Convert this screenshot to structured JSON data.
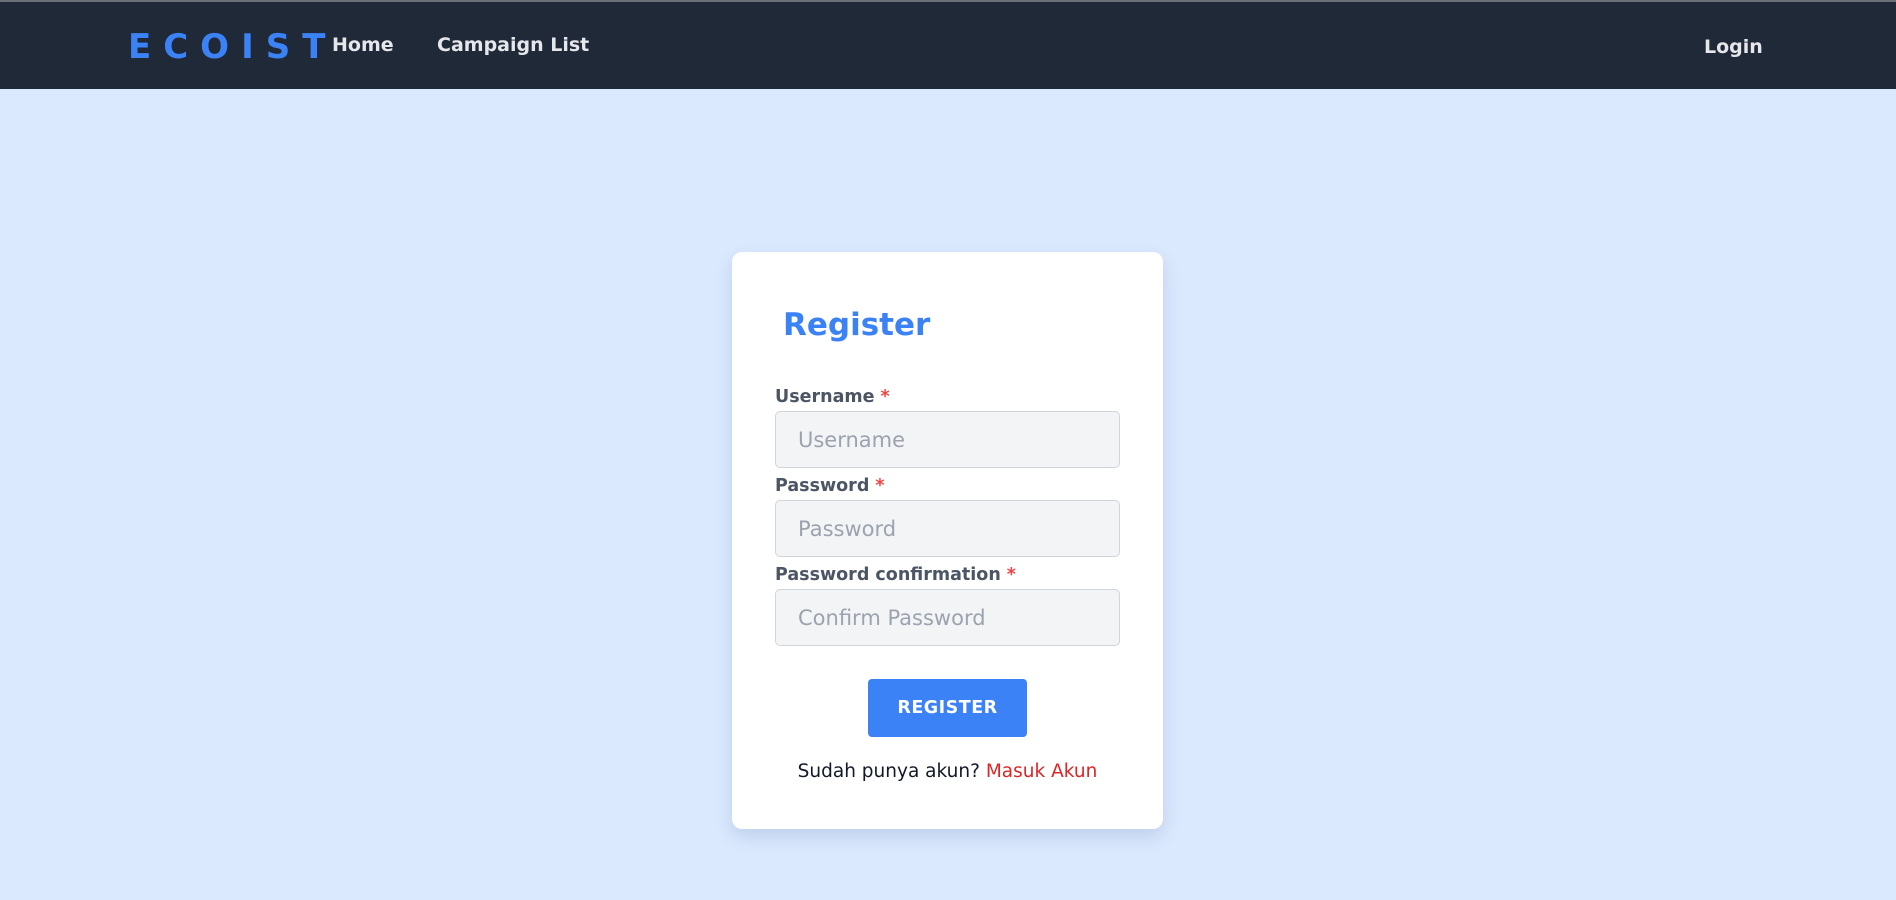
{
  "navbar": {
    "brand": "ECOIST",
    "links": [
      {
        "label": "Home"
      },
      {
        "label": "Campaign List"
      }
    ],
    "login_label": "Login"
  },
  "register_form": {
    "title": "Register",
    "required_marker": "*",
    "fields": [
      {
        "label": "Username",
        "placeholder": "Username",
        "value": ""
      },
      {
        "label": "Password",
        "placeholder": "Password",
        "value": ""
      },
      {
        "label": "Password confirmation",
        "placeholder": "Confirm Password",
        "value": ""
      }
    ],
    "submit_label": "REGISTER",
    "footer_prompt": "Sudah punya akun?",
    "footer_link": "Masuk Akun"
  },
  "colors": {
    "accent": "#3b82f6",
    "navbar_bg": "#1f2937",
    "page_bg": "#dbe9fe",
    "required": "#ef4444",
    "link": "#dc2626"
  }
}
